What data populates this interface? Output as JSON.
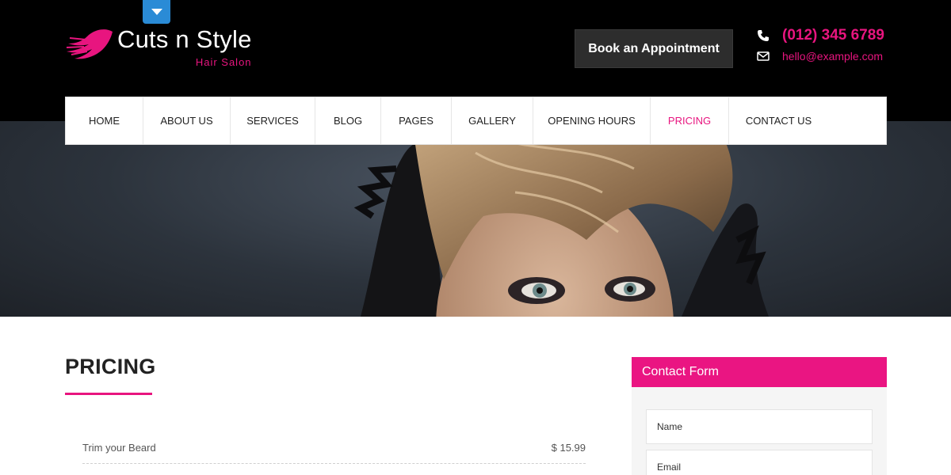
{
  "brand": {
    "name": "Cuts n Style",
    "tagline": "Hair Salon",
    "accent_color": "#e8157f"
  },
  "header": {
    "book_label": "Book an Appointment",
    "phone": "(012) 345 6789",
    "email": "hello@example.com",
    "phone_icon": "phone-icon",
    "email_icon": "envelope-icon",
    "toggle_icon": "caret-down-icon"
  },
  "nav": {
    "items": [
      {
        "label": "HOME"
      },
      {
        "label": "ABOUT US"
      },
      {
        "label": "SERVICES"
      },
      {
        "label": "BLOG"
      },
      {
        "label": "PAGES"
      },
      {
        "label": "GALLERY"
      },
      {
        "label": "OPENING HOURS"
      },
      {
        "label": "PRICING"
      },
      {
        "label": "CONTACT US"
      }
    ],
    "active_index": 7
  },
  "main": {
    "title": "PRICING",
    "prices": [
      {
        "name": "Trim your Beard",
        "price": "$ 15.99"
      }
    ]
  },
  "sidebar": {
    "heading": "Contact Form",
    "name_placeholder": "Name",
    "email_placeholder": "Email"
  }
}
